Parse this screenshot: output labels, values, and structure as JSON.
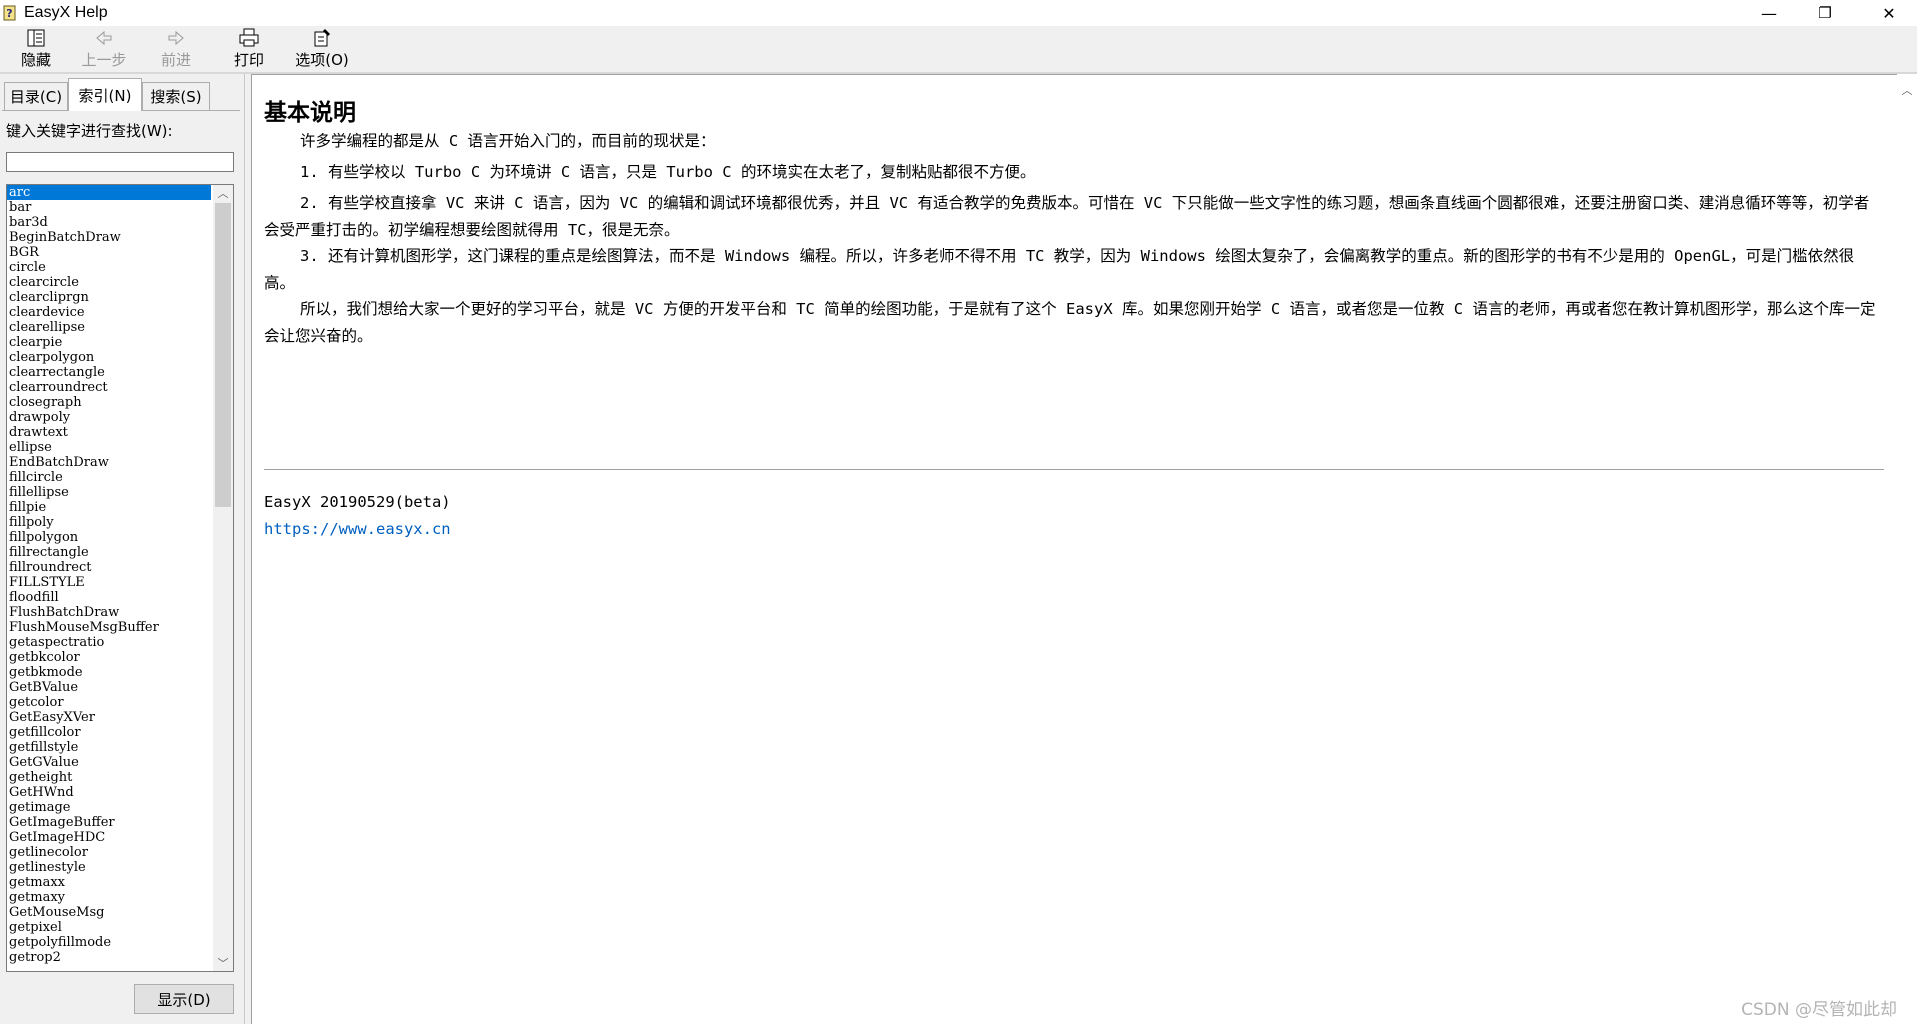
{
  "window": {
    "title": "EasyX Help",
    "controls": {
      "minimize": "—",
      "restore": "❐",
      "close": "✕"
    }
  },
  "toolbar": {
    "hide_label": "隐藏",
    "back_label": "上一步",
    "forward_label": "前进",
    "print_label": "打印",
    "options_label": "选项(O)"
  },
  "sidebar": {
    "tabs": [
      "目录(C)",
      "索引(N)",
      "搜索(S)"
    ],
    "active_tab": "索引(N)",
    "search_label": "键入关键字进行查找(W):",
    "search_value": "",
    "index_items": [
      "arc",
      "bar",
      "bar3d",
      "BeginBatchDraw",
      "BGR",
      "circle",
      "clearcircle",
      "clearcliprgn",
      "cleardevice",
      "clearellipse",
      "clearpie",
      "clearpolygon",
      "clearrectangle",
      "clearroundrect",
      "closegraph",
      "drawpoly",
      "drawtext",
      "ellipse",
      "EndBatchDraw",
      "fillcircle",
      "fillellipse",
      "fillpie",
      "fillpoly",
      "fillpolygon",
      "fillrectangle",
      "fillroundrect",
      "FILLSTYLE",
      "floodfill",
      "FlushBatchDraw",
      "FlushMouseMsgBuffer",
      "getaspectratio",
      "getbkcolor",
      "getbkmode",
      "GetBValue",
      "getcolor",
      "GetEasyXVer",
      "getfillcolor",
      "getfillstyle",
      "GetGValue",
      "getheight",
      "GetHWnd",
      "getimage",
      "GetImageBuffer",
      "GetImageHDC",
      "getlinecolor",
      "getlinestyle",
      "getmaxx",
      "getmaxy",
      "GetMouseMsg",
      "getpixel",
      "getpolyfillmode",
      "getrop2"
    ],
    "selected_item": "arc",
    "show_button": "显示(D)"
  },
  "content": {
    "title": "基本说明",
    "paragraphs": [
      "许多学编程的都是从 C 语言开始入门的，而目前的现状是：",
      "1. 有些学校以 Turbo C 为环境讲 C 语言，只是 Turbo C 的环境实在太老了，复制粘贴都很不方便。",
      "2. 有些学校直接拿 VC 来讲 C 语言，因为 VC 的编辑和调试环境都很优秀，并且 VC 有适合教学的免费版本。可惜在 VC 下只能做一些文字性的练习题，想画条直线画个圆都很难，还要注册窗口类、建消息循环等等，初学者会受严重打击的。初学编程想要绘图就得用 TC，很是无奈。",
      "3. 还有计算机图形学，这门课程的重点是绘图算法，而不是 Windows 编程。所以，许多老师不得不用 TC 教学，因为 Windows 绘图太复杂了，会偏离教学的重点。新的图形学的书有不少是用的 OpenGL，可是门槛依然很高。",
      "所以，我们想给大家一个更好的学习平台，就是 VC 方便的开发平台和 TC 简单的绘图功能，于是就有了这个 EasyX 库。如果您刚开始学 C 语言，或者您是一位教 C 语言的老师，再或者您在教计算机图形学，那么这个库一定会让您兴奋的。"
    ],
    "version": "EasyX 20190529(beta)",
    "link": "https://www.easyx.cn"
  },
  "watermark": "CSDN @尽管如此却",
  "colors": {
    "selection": "#0078d7",
    "link": "#0060c0",
    "chrome": "#f0f0f0"
  }
}
